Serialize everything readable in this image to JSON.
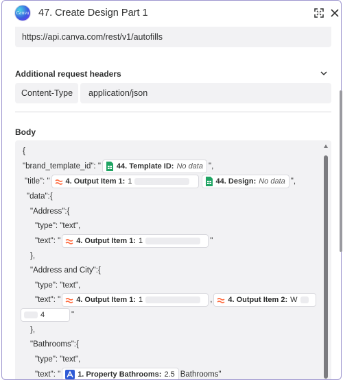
{
  "header": {
    "app_logo_text": "Canva",
    "title": "47. Create Design Part 1"
  },
  "url": {
    "value": "https://api.canva.com/rest/v1/autofills"
  },
  "headers_section": {
    "label": "Additional request headers",
    "key": "Content-Type",
    "value": "application/json"
  },
  "body_section": {
    "label": "Body",
    "lines": {
      "l1": "{",
      "l2_pre": "\"brand_template_id\": \"",
      "l2_pill_label": "44. Template ID:",
      "l2_pill_value": "No data",
      "l2_post": "\",",
      "l3_pre": "\"title\": \"",
      "l3_pill1_label": "4. Output Item 1:",
      "l3_pill1_value": "1",
      "l3_pill2_label": "44. Design:",
      "l3_pill2_value": "No data",
      "l3_post": "\",",
      "l4": "\"data\":{",
      "l5": "\"Address\":{",
      "l6": "\"type\": \"text\",",
      "l7_pre": "\"text\": \"",
      "l7_pill_label": "4. Output Item 1:",
      "l7_pill_value": "1",
      "l7_post": "\"",
      "l8": "},",
      "l9": "\"Address and City\":{",
      "l10": "\"type\": \"text\",",
      "l11_pre": "\"text\": \"",
      "l11_pill1_label": "4. Output Item 1:",
      "l11_pill1_value": "1",
      "l11_sep": ",",
      "l11_pill2_label": "4. Output Item 2:",
      "l11_pill2_value": "W",
      "l12_value": "4",
      "l12_post": "\"",
      "l13": "},",
      "l14": "\"Bathrooms\":{",
      "l15": "\"type\": \"text\",",
      "l16_pre": "\"text\": \"",
      "l16_pill_label": "1. Property Bathrooms:",
      "l16_pill_value": "2.5",
      "l16_post": "Bathrooms\""
    }
  },
  "colors": {
    "accent_border": "#9e96cf",
    "field_bg": "#f2f2f4",
    "sheets_green": "#1fa463",
    "formatter_orange": "#ff6a3d",
    "property_blue": "#2f5bd6"
  },
  "icons": {
    "sheets": "google-sheets-icon",
    "formatter": "formatter-icon",
    "property": "property-app-icon"
  }
}
